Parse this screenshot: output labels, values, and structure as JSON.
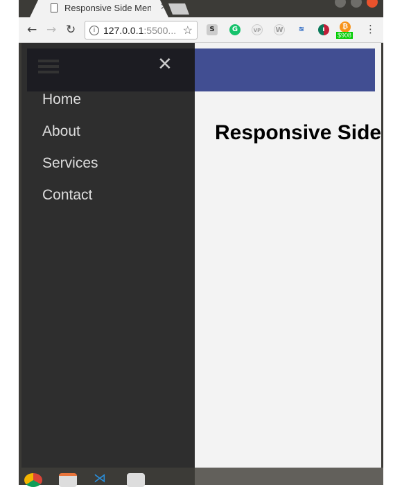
{
  "browser": {
    "tab_title": "Responsive Side Menu",
    "url_host": "127.0.0.1",
    "url_rest": ":5500...",
    "extension_badge": "$908",
    "extensions": [
      "s-icon",
      "grammarly-icon",
      "vp-icon",
      "wordpress-icon",
      "steem-icon",
      "tradingview-icon",
      "bitcoin-icon"
    ]
  },
  "page": {
    "menu": [
      "Home",
      "About",
      "Services",
      "Contact"
    ],
    "heading": "Responsive Side Menu",
    "header_color": "#414e92",
    "sidebar_color": "#2e2e2e"
  },
  "taskbar": {
    "apps": [
      "chrome-icon",
      "files-icon",
      "vscode-icon",
      "speaker-icon"
    ]
  }
}
